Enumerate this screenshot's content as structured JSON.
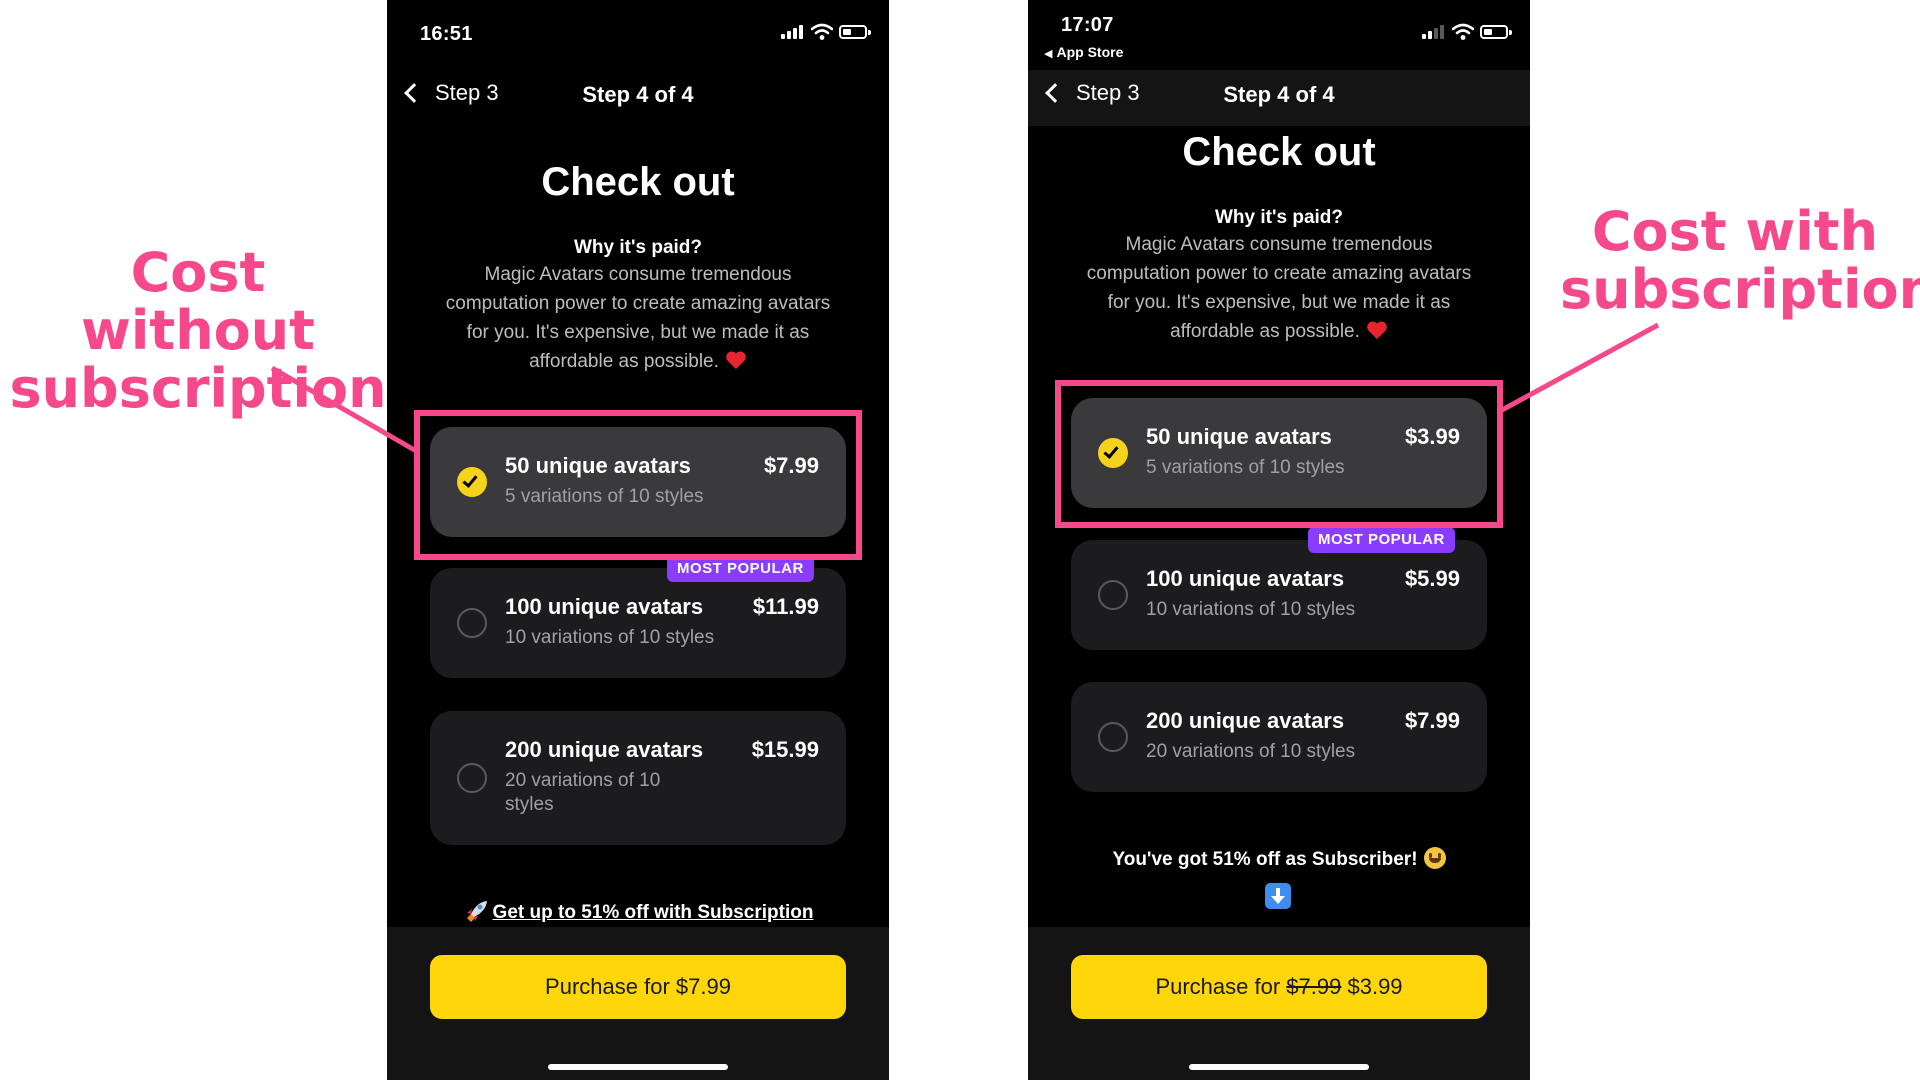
{
  "annotations": {
    "left_label": "Cost without subscription",
    "right_label": "Cost with subscription",
    "accent_color": "#f5498b"
  },
  "screens": [
    {
      "status": {
        "time": "16:51",
        "back_app": ""
      },
      "nav": {
        "back_label": "Step 3",
        "title": "Step 4 of 4"
      },
      "page_title": "Check out",
      "why_title": "Why it's paid?",
      "why_body": "Magic Avatars consume tremendous computation power to create amazing avatars for you. It's expensive, but we made it as affordable as possible.",
      "plans": [
        {
          "name": "50 unique avatars",
          "desc": "5 variations of 10 styles",
          "price": "$7.99",
          "selected": true
        },
        {
          "name": "100 unique avatars",
          "desc": "10 variations of 10 styles",
          "price": "$11.99",
          "selected": false,
          "badge": "MOST POPULAR"
        },
        {
          "name": "200 unique avatars",
          "desc": "20 variations of 10 styles",
          "price": "$15.99",
          "selected": false
        }
      ],
      "promo_link": "Get up to 51% off with Subscription",
      "purchase": {
        "label": "Purchase for $7.99"
      }
    },
    {
      "status": {
        "time": "17:07",
        "back_app": "App Store"
      },
      "nav": {
        "back_label": "Step 3",
        "title": "Step 4 of 4"
      },
      "page_title": "Check out",
      "why_title": "Why it's paid?",
      "why_body": "Magic Avatars consume tremendous computation power to create amazing avatars for you. It's expensive, but we made it as affordable as possible.",
      "plans": [
        {
          "name": "50 unique avatars",
          "desc": "5 variations of 10 styles",
          "price": "$3.99",
          "selected": true
        },
        {
          "name": "100 unique avatars",
          "desc": "10 variations of 10 styles",
          "price": "$5.99",
          "selected": false,
          "badge": "MOST POPULAR"
        },
        {
          "name": "200 unique avatars",
          "desc": "20 variations of 10 styles",
          "price": "$7.99",
          "selected": false
        }
      ],
      "subscriber_note": "You've got 51% off as Subscriber!",
      "purchase": {
        "prefix": "Purchase for",
        "old_price": "$7.99",
        "new_price": "$3.99"
      }
    }
  ]
}
